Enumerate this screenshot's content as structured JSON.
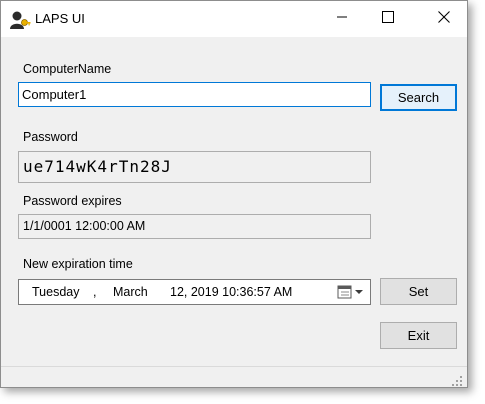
{
  "window": {
    "title": "LAPS UI"
  },
  "computer": {
    "label": "ComputerName",
    "value": "Computer1"
  },
  "search_button": "Search",
  "password": {
    "label": "Password",
    "value": "ue714wK4rTn28J"
  },
  "expires": {
    "label": "Password expires",
    "value": "1/1/0001 12:00:00 AM"
  },
  "new_expiration": {
    "label": "New expiration time",
    "weekday": "Tuesday",
    "comma": ",",
    "month": "March",
    "rest": "12, 2019 10:36:57 AM"
  },
  "set_button": "Set",
  "exit_button": "Exit",
  "colors": {
    "accent": "#0078d7",
    "window_bg": "#f0f0f0"
  }
}
